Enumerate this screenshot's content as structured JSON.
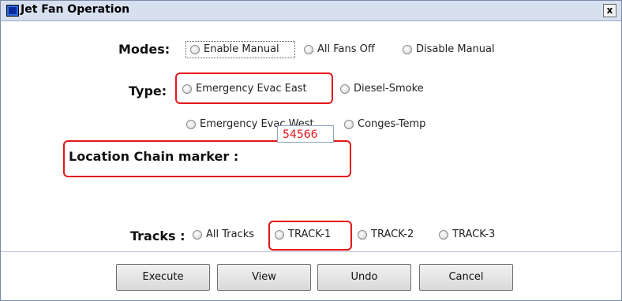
{
  "window": {
    "title": "Jet Fan Operation",
    "close_label": "x"
  },
  "modes": {
    "label": "Modes:",
    "options": [
      "Enable Manual",
      "All Fans Off",
      "Disable Manual"
    ]
  },
  "type": {
    "label": "Type:",
    "options": [
      "Emergency Evac East",
      "Diesel-Smoke",
      "Emergency Evac West",
      "Conges-Temp"
    ]
  },
  "location": {
    "label": "Location Chain marker :",
    "value": "54566"
  },
  "tracks": {
    "label": "Tracks :",
    "options": [
      "All Tracks",
      "TRACK-1",
      "TRACK-2",
      "TRACK-3"
    ]
  },
  "buttons": {
    "execute": "Execute",
    "view": "View",
    "undo": "Undo",
    "cancel": "Cancel"
  },
  "colors": {
    "highlight": "#e4161b",
    "value_text": "#e4161b",
    "titlebar": "#d6e0ef"
  }
}
